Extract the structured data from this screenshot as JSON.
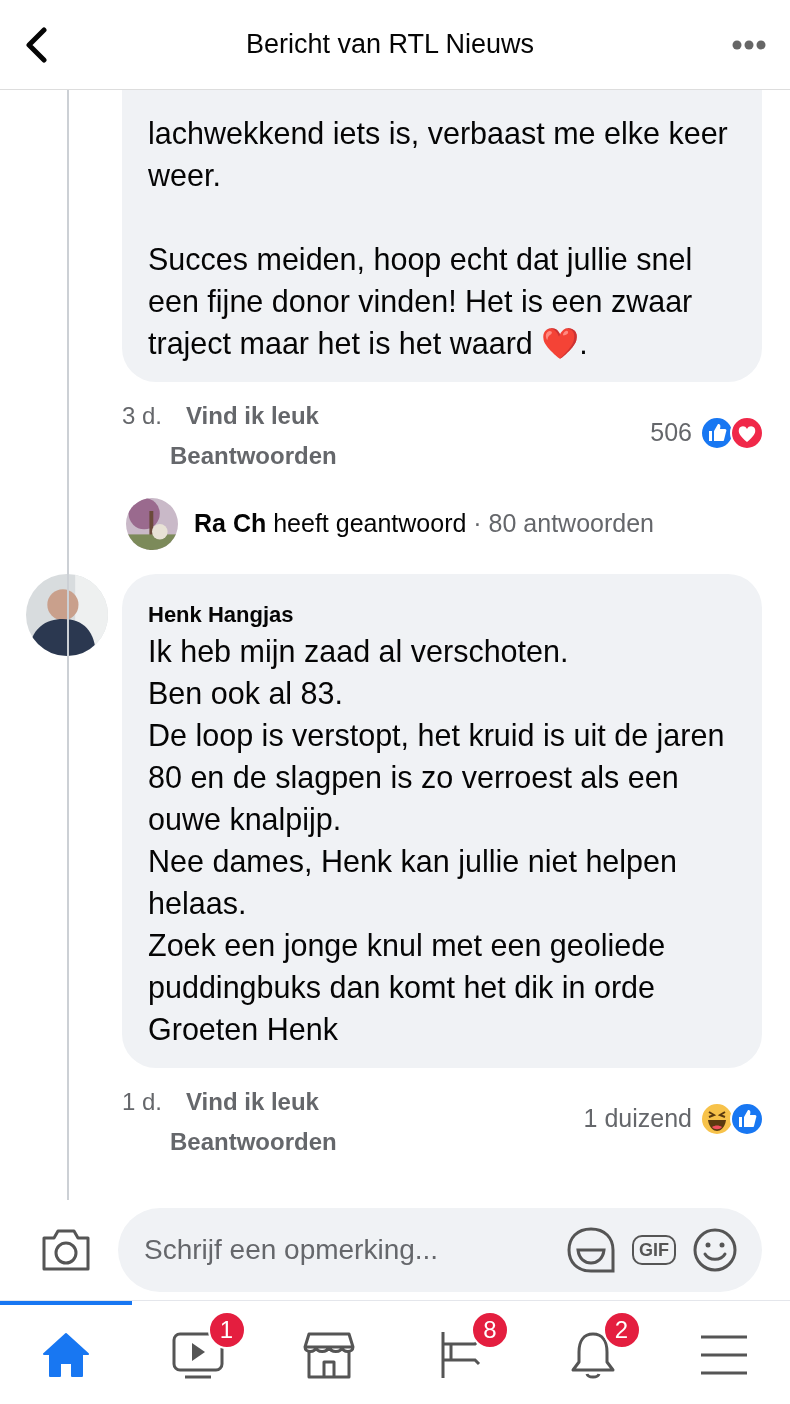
{
  "header": {
    "title": "Bericht van RTL Nieuws"
  },
  "comments": [
    {
      "kind": "continued",
      "paragraphs": [
        "lachwekkend iets is, verbaast me elke keer weer.",
        "Succes meiden, hoop echt dat jullie snel een fijne donor vinden! Het is een zwaar traject maar het is het waard ❤️."
      ],
      "time": "3 d.",
      "like_label": "Vind ik leuk",
      "reply_label": "Beantwoorden",
      "reaction_count": "506",
      "reactions": [
        {
          "kind": "like"
        },
        {
          "kind": "love"
        }
      ],
      "replies_summary": {
        "name": "Ra Ch",
        "action": "heeft geantwoord",
        "count": "· 80 antwoorden"
      }
    },
    {
      "author": "Henk Hangjas",
      "kind": "full",
      "paragraphs": [
        "Ik heb mijn zaad al verschoten.",
        "Ben ook al 83.",
        "De loop is verstopt, het kruid is uit de jaren 80 en de slagpen is zo verroest als een ouwe knalpijp.",
        "Nee dames, Henk kan jullie niet helpen helaas.",
        "Zoek een jonge knul met een geoliede puddingbuks dan komt het dik in orde",
        "Groeten Henk"
      ],
      "time": "1 d.",
      "like_label": "Vind ik leuk",
      "reply_label": "Beantwoorden",
      "reaction_count": "1 duizend",
      "reactions": [
        {
          "kind": "haha"
        },
        {
          "kind": "like"
        }
      ]
    }
  ],
  "composer": {
    "placeholder": "Schrijf een opmerking...",
    "gif_label": "GIF"
  },
  "tabs": [
    {
      "selected": true
    },
    {
      "badge": "1",
      "selected": false
    },
    {
      "selected": false
    },
    {
      "badge": "8",
      "selected": false
    },
    {
      "badge": "2",
      "selected": false
    },
    {
      "selected": false
    }
  ]
}
